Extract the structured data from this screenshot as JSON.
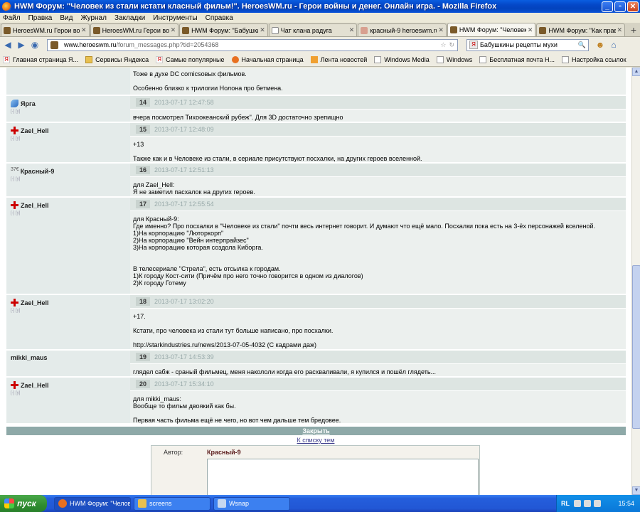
{
  "window": {
    "title": "HWM Форум: \"Человек из стали кстати класный фильм!\". HeroesWM.ru - Герои войны и денег. Онлайн игра. - Mozilla Firefox"
  },
  "menu": [
    "Файл",
    "Правка",
    "Вид",
    "Журнал",
    "Закладки",
    "Инструменты",
    "Справка"
  ],
  "tabs": [
    {
      "label": "HeroesWM.ru Герои войн...",
      "icon": "hwm-favicon",
      "active": false
    },
    {
      "label": "HeroesWM.ru Герои войн...",
      "icon": "hwm-favicon",
      "active": false
    },
    {
      "label": "HWM Форум: \"Бабушкин...",
      "icon": "hwm-favicon",
      "active": false
    },
    {
      "label": "Чат клана радуга",
      "icon": "blank-page",
      "active": false
    },
    {
      "label": "красный-9 heroeswm.ru-...",
      "icon": "yandex-favicon",
      "active": false
    },
    {
      "label": "HWM Форум: \"Человек и...",
      "icon": "hwm-favicon",
      "active": true
    },
    {
      "label": "HWM Форум: \"Как прави...",
      "icon": "hwm-favicon",
      "active": false
    }
  ],
  "nav": {
    "url_domain": "www.heroeswm.ru",
    "url_path": "/forum_messages.php?tid=2054368",
    "search_value": "Бабушкины рецепты мухи"
  },
  "bookmarks": [
    {
      "label": "Главная страница Я...",
      "icon": "yandex"
    },
    {
      "label": "Сервисы Яндекса",
      "icon": "folder"
    },
    {
      "label": "Самые популярные",
      "icon": "yandex"
    },
    {
      "label": "Начальная страница",
      "icon": "firefox"
    },
    {
      "label": "Лента новостей",
      "icon": "rss"
    },
    {
      "label": "Windows Media",
      "icon": "page"
    },
    {
      "label": "Windows",
      "icon": "page"
    },
    {
      "label": "Бесплатная почта Н...",
      "icon": "page"
    },
    {
      "label": "Настройка ссылок",
      "icon": "page"
    }
  ],
  "posts": [
    {
      "author": "",
      "icon": "",
      "num": "",
      "date": "",
      "text": "Тоже в духе DC comicsовых фильмов.\n\nОсобенно близко к трилогии Нолона про бетмена."
    },
    {
      "author": "Ярга",
      "icon": "gem",
      "num": "14",
      "date": "2013-07-17 12:47:58",
      "text": "вчера посмотрел Тихоокеанский рубеж\". Для 3D достаточно зрепищно"
    },
    {
      "author": "Zael_Hell",
      "icon": "cross",
      "num": "15",
      "date": "2013-07-17 12:48:09",
      "text": "+13\n\nТакже как и в Человеке из стали, в сериале присутствуют посхалки, на других героев вселенной."
    },
    {
      "author": "Красный-9",
      "icon": "num",
      "icon_text": "37€",
      "num": "16",
      "date": "2013-07-17 12:51:13",
      "text": "для Zael_Hell:\nЯ не заметил пасхалок на других героев."
    },
    {
      "author": "Zael_Hell",
      "icon": "cross",
      "num": "17",
      "date": "2013-07-17 12:55:54",
      "text": "для Красный-9:\nГде именно? Про посхалки в \"Человеке из стали\" почти весь интернет говорит. И думают что ещё мало. Посхалки пока есть на 3-ёх персонажей вселеной.\n1)На корпорацию \"Люторкорп\"\n2)На корпорацию \"Вейн интерпрайзес\"\n3)На корпорацию которая создола Киборга.\n\n\nВ телесериале \"Стрела\", есть отсылка к городам.\n1)К городу Кост-сити (Причём про него точно говорится в одном из диалогов)\n2)К городу Готему"
    },
    {
      "author": "Zael_Hell",
      "icon": "cross",
      "num": "18",
      "date": "2013-07-17 13:02:20",
      "text": "+17.\n\nКстати, про человека из стали тут больше написано, про посхалки.\n\nhttp://starkindustries.ru/news/2013-07-05-4032 (С кадрами даж)"
    },
    {
      "author": "mikki_maus",
      "icon": "",
      "num": "19",
      "date": "2013-07-17 14:53:39",
      "text": "глядел сабж - сраный фильмец, меня накололи когда его расхваливали, я купился и пошёл глядеть..."
    },
    {
      "author": "Zael_Hell",
      "icon": "cross",
      "num": "20",
      "date": "2013-07-17 15:34:10",
      "text": "для mikki_maus:\nВообще то фильм двоякий как бы.\n\nПервая часть фильма ещё не чего, но вот чем дальше тем бредовее."
    }
  ],
  "author_level": "[-] [у]",
  "close_label": "Закрыть",
  "to_list_label": "К списку тем",
  "reply": {
    "author_label": "Автор:",
    "author_name": "Красный-9"
  },
  "taskbar": {
    "start_label": "пуск",
    "tasks": [
      {
        "label": "HWM Форум: \"Челове...",
        "icon": "firefox"
      },
      {
        "label": "screens",
        "icon": "folder"
      },
      {
        "label": "Wsnap",
        "icon": "snap"
      }
    ],
    "lang": "RL",
    "clock": "15:54"
  }
}
